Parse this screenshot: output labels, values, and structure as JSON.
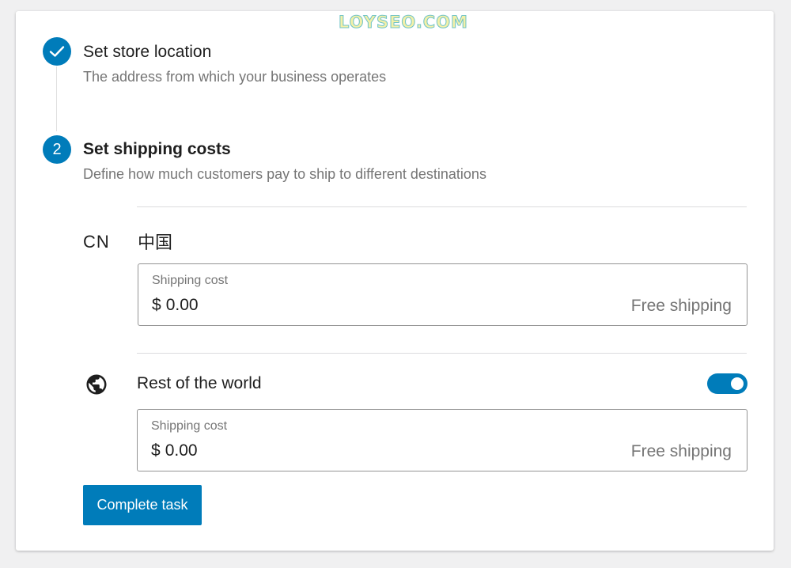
{
  "watermark": "LOYSEO.COM",
  "colors": {
    "accent": "#007cba",
    "background": "#f0f0f1",
    "card": "#ffffff",
    "text_primary": "#1e1e1e",
    "text_secondary": "#757575"
  },
  "steps": [
    {
      "status": "complete",
      "marker_icon": "checkmark-icon",
      "title": "Set store location",
      "description": "The address from which your business operates"
    },
    {
      "status": "active",
      "marker_number": "2",
      "title": "Set shipping costs",
      "description": "Define how much customers pay to ship to different destinations"
    }
  ],
  "shipping": {
    "zones": [
      {
        "code": "CN",
        "name": "中国",
        "cost_field": {
          "label": "Shipping cost",
          "currency": "$",
          "value": "0.00",
          "suffix": "Free shipping"
        }
      },
      {
        "icon": "globe-icon",
        "name": "Rest of the world",
        "enabled": true,
        "cost_field": {
          "label": "Shipping cost",
          "currency": "$",
          "value": "0.00",
          "suffix": "Free shipping"
        }
      }
    ]
  },
  "actions": {
    "complete_label": "Complete task"
  }
}
